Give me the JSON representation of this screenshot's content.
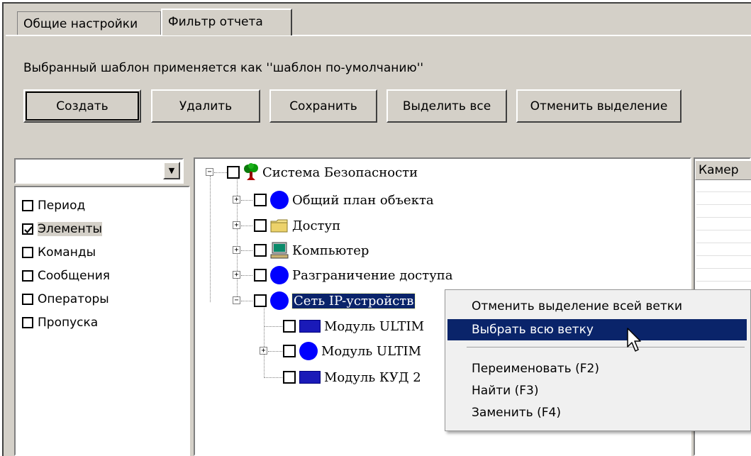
{
  "tabs": [
    {
      "label": "Общие настройки"
    },
    {
      "label": "Фильтр отчета"
    }
  ],
  "info_text": "Выбранный шаблон применяется как ''шаблон по-умолчанию''",
  "toolbar": {
    "create": "Создать",
    "delete": "Удалить",
    "save": "Сохранить",
    "select_all": "Выделить все",
    "deselect": "Отменить выделение"
  },
  "filter_combo": {
    "value": ""
  },
  "categories": [
    {
      "label": "Период",
      "checked": false
    },
    {
      "label": "Элементы",
      "checked": true
    },
    {
      "label": "Команды",
      "checked": false
    },
    {
      "label": "Сообщения",
      "checked": false
    },
    {
      "label": "Операторы",
      "checked": false
    },
    {
      "label": "Пропуска",
      "checked": false
    }
  ],
  "tree": {
    "root": "Система Безопасности",
    "children": [
      {
        "label": "Общий план объекта",
        "icon": "blue-circle-icon"
      },
      {
        "label": "Доступ",
        "icon": "folder-icon"
      },
      {
        "label": "Компьютер",
        "icon": "computer-icon"
      },
      {
        "label": "Разграничение доступа",
        "icon": "blue-circle-icon"
      },
      {
        "label": "Сеть IP-устройств",
        "icon": "blue-circle-icon"
      }
    ],
    "subchildren": [
      {
        "label": "Модуль ULTIM",
        "icon": "module-icon"
      },
      {
        "label": "Модуль ULTIM",
        "icon": "blue-circle-icon"
      },
      {
        "label": "Модуль КУД 2",
        "icon": "module-icon"
      }
    ]
  },
  "right_header": "Камер",
  "context_menu": {
    "items": [
      {
        "label": "Отменить выделение всей ветки"
      },
      {
        "label": "Выбрать всю ветку"
      },
      {
        "label": "Переименовать (F2)"
      },
      {
        "label": "Найти (F3)"
      },
      {
        "label": "Заменить (F4)"
      }
    ]
  },
  "colors": {
    "highlight": "#0a246a",
    "face": "#d4d0c8",
    "node_blue": "#0000ff"
  }
}
